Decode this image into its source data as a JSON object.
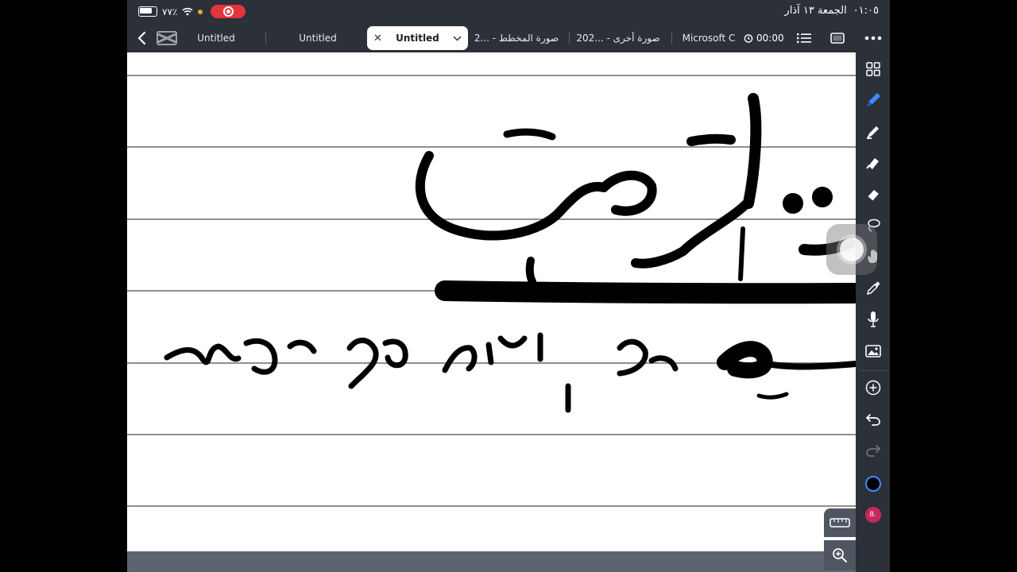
{
  "status_bar": {
    "battery_percent": "٧٧٪",
    "time": "٠١:٠٥",
    "date": "الجمعة ١٣ آذار"
  },
  "tabs": [
    {
      "label": "Untitled"
    },
    {
      "label": "Untitled"
    },
    {
      "label": "Untitled",
      "active": true
    },
    {
      "label": "صورة المخطط - ...2"
    },
    {
      "label": "صورة أخرى - ...202"
    },
    {
      "label": "Microsoft C"
    }
  ],
  "timer": {
    "value": "00:00"
  },
  "tools": {
    "active_tool": "pen",
    "current_color": "#000000",
    "stroke_size_label": "8.",
    "accent_color": "#3d8bff"
  },
  "icons": [
    "back-icon",
    "capcut-icon",
    "close-icon",
    "chevron-down-icon",
    "timer-icon",
    "list-icon",
    "page-icon",
    "more-icon",
    "grid-icon",
    "pen-icon",
    "highlighter-icon",
    "eraser-icon",
    "tape-icon",
    "lasso-icon",
    "hand-icon",
    "eyedropper-icon",
    "mic-icon",
    "image-icon",
    "add-icon",
    "undo-icon",
    "redo-icon",
    "ruler-icon",
    "zoom-icon"
  ]
}
